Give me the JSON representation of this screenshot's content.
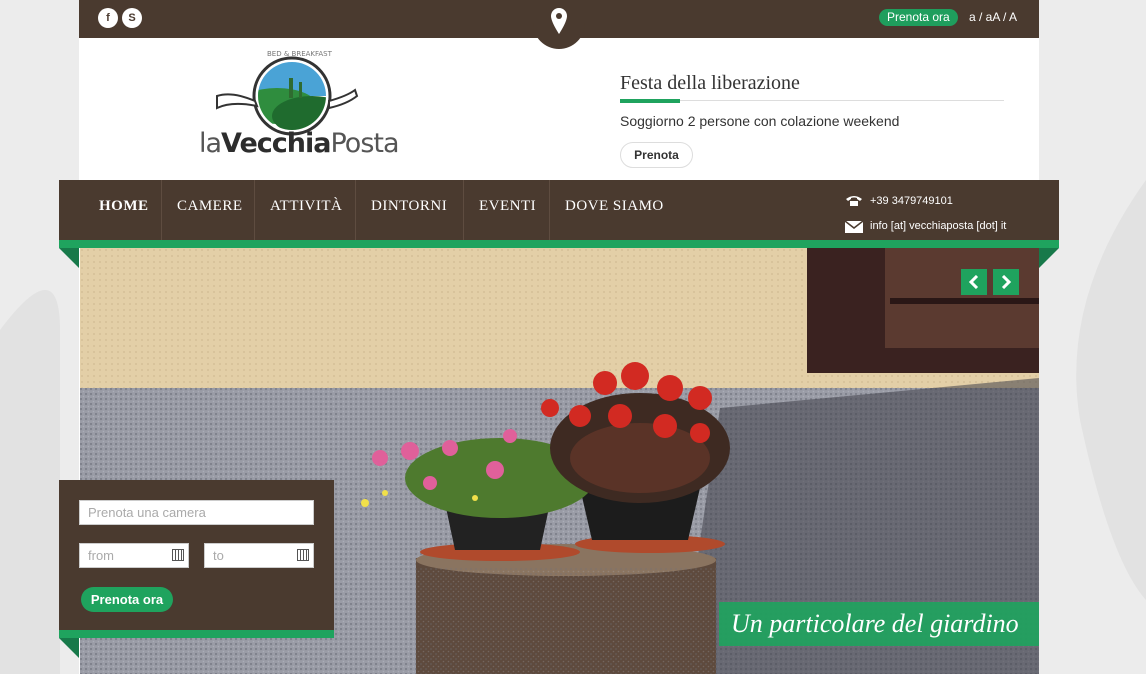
{
  "topbar": {
    "social": [
      {
        "icon": "facebook-icon",
        "glyph": "f"
      },
      {
        "icon": "skype-icon",
        "glyph": "S"
      }
    ],
    "map_icon": "map-pin-icon",
    "book_label": "Prenota ora",
    "font_size_label": "a / aA / A"
  },
  "header": {
    "logo_small_text": "BED & BREAKFAST",
    "logo_text_a": "la",
    "logo_text_b": "Vecchia",
    "logo_text_c": "Posta",
    "news_title": "Festa della liberazione",
    "news_text": "Soggiorno 2 persone con colazione weekend",
    "news_button": "Prenota"
  },
  "nav": {
    "items": [
      {
        "label": "HOME",
        "active": true
      },
      {
        "label": "CAMERE"
      },
      {
        "label": "ATTIVITÀ"
      },
      {
        "label": "DINTORNI"
      },
      {
        "label": "EVENTI"
      },
      {
        "label": "DOVE SIAMO"
      }
    ],
    "phone": "+39 3479749101",
    "email": "info [at] vecchiaposta [dot] it"
  },
  "hero": {
    "caption": "Un particolare del giardino"
  },
  "booking": {
    "room_placeholder": "Prenota una camera",
    "from_placeholder": "from",
    "to_placeholder": "to",
    "button_label": "Prenota ora"
  },
  "colors": {
    "brown": "#4a3a2f",
    "green": "#1fa35e"
  }
}
